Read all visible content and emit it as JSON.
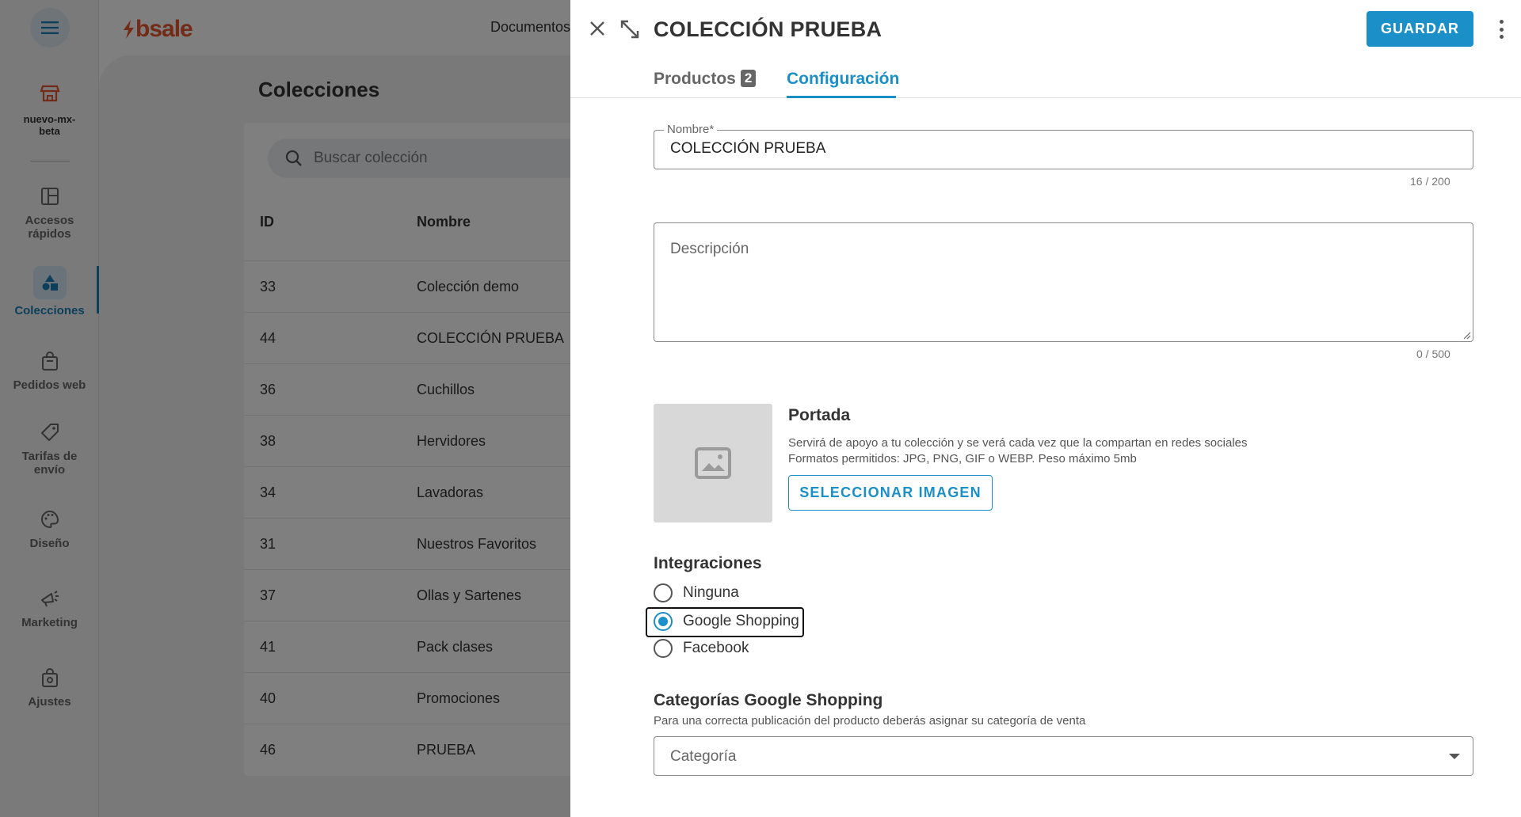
{
  "rail": {
    "store_name": "nuevo-mx-beta",
    "items": [
      {
        "label": "Accesos rápidos",
        "icon": "dashboard-icon"
      },
      {
        "label": "Colecciones",
        "icon": "shapes-icon",
        "active": true
      },
      {
        "label": "Pedidos web",
        "icon": "shopping-bag-icon"
      },
      {
        "label": "Tarifas de envío",
        "icon": "tag-icon"
      },
      {
        "label": "Diseño",
        "icon": "palette-icon"
      },
      {
        "label": "Marketing",
        "icon": "megaphone-icon"
      },
      {
        "label": "Ajustes",
        "icon": "settings-bag-icon"
      }
    ]
  },
  "topbar": {
    "brand": "bsale",
    "nav_item": "Documentos"
  },
  "collections": {
    "title": "Colecciones",
    "search_placeholder": "Buscar colección",
    "columns": [
      "ID",
      "Nombre"
    ],
    "rows": [
      {
        "id": "33",
        "name": "Colección demo"
      },
      {
        "id": "44",
        "name": "COLECCIÓN PRUEBA"
      },
      {
        "id": "36",
        "name": "Cuchillos"
      },
      {
        "id": "38",
        "name": "Hervidores"
      },
      {
        "id": "34",
        "name": "Lavadoras"
      },
      {
        "id": "31",
        "name": "Nuestros Favoritos"
      },
      {
        "id": "37",
        "name": "Ollas y Sartenes"
      },
      {
        "id": "41",
        "name": "Pack clases"
      },
      {
        "id": "40",
        "name": "Promociones"
      },
      {
        "id": "46",
        "name": "PRUEBA"
      }
    ]
  },
  "drawer": {
    "title": "COLECCIÓN PRUEBA",
    "save_label": "GUARDAR",
    "tabs": [
      {
        "label": "Productos",
        "badge": "2"
      },
      {
        "label": "Configuración",
        "active": true
      }
    ],
    "name_field": {
      "label": "Nombre*",
      "value": "COLECCIÓN PRUEBA",
      "counter": "16 / 200"
    },
    "description_field": {
      "placeholder": "Descripción",
      "counter": "0 / 500"
    },
    "cover": {
      "title": "Portada",
      "help_line1": "Servirá de apoyo a tu colección y se verá cada vez que la compartan en redes sociales",
      "help_line2": "Formatos permitidos: JPG, PNG, GIF o WEBP. Peso máximo 5mb",
      "button_label": "SELECCIONAR IMAGEN"
    },
    "integrations": {
      "title": "Integraciones",
      "options": [
        {
          "label": "Ninguna",
          "selected": false
        },
        {
          "label": "Google Shopping",
          "selected": true
        },
        {
          "label": "Facebook",
          "selected": false
        }
      ]
    },
    "categories": {
      "title": "Categorías Google Shopping",
      "help": "Para una correcta publicación del producto deberás asignar su categoría de venta",
      "placeholder": "Categoría"
    }
  },
  "colors": {
    "accent": "#1b8fc7",
    "brand": "#e4572e"
  }
}
